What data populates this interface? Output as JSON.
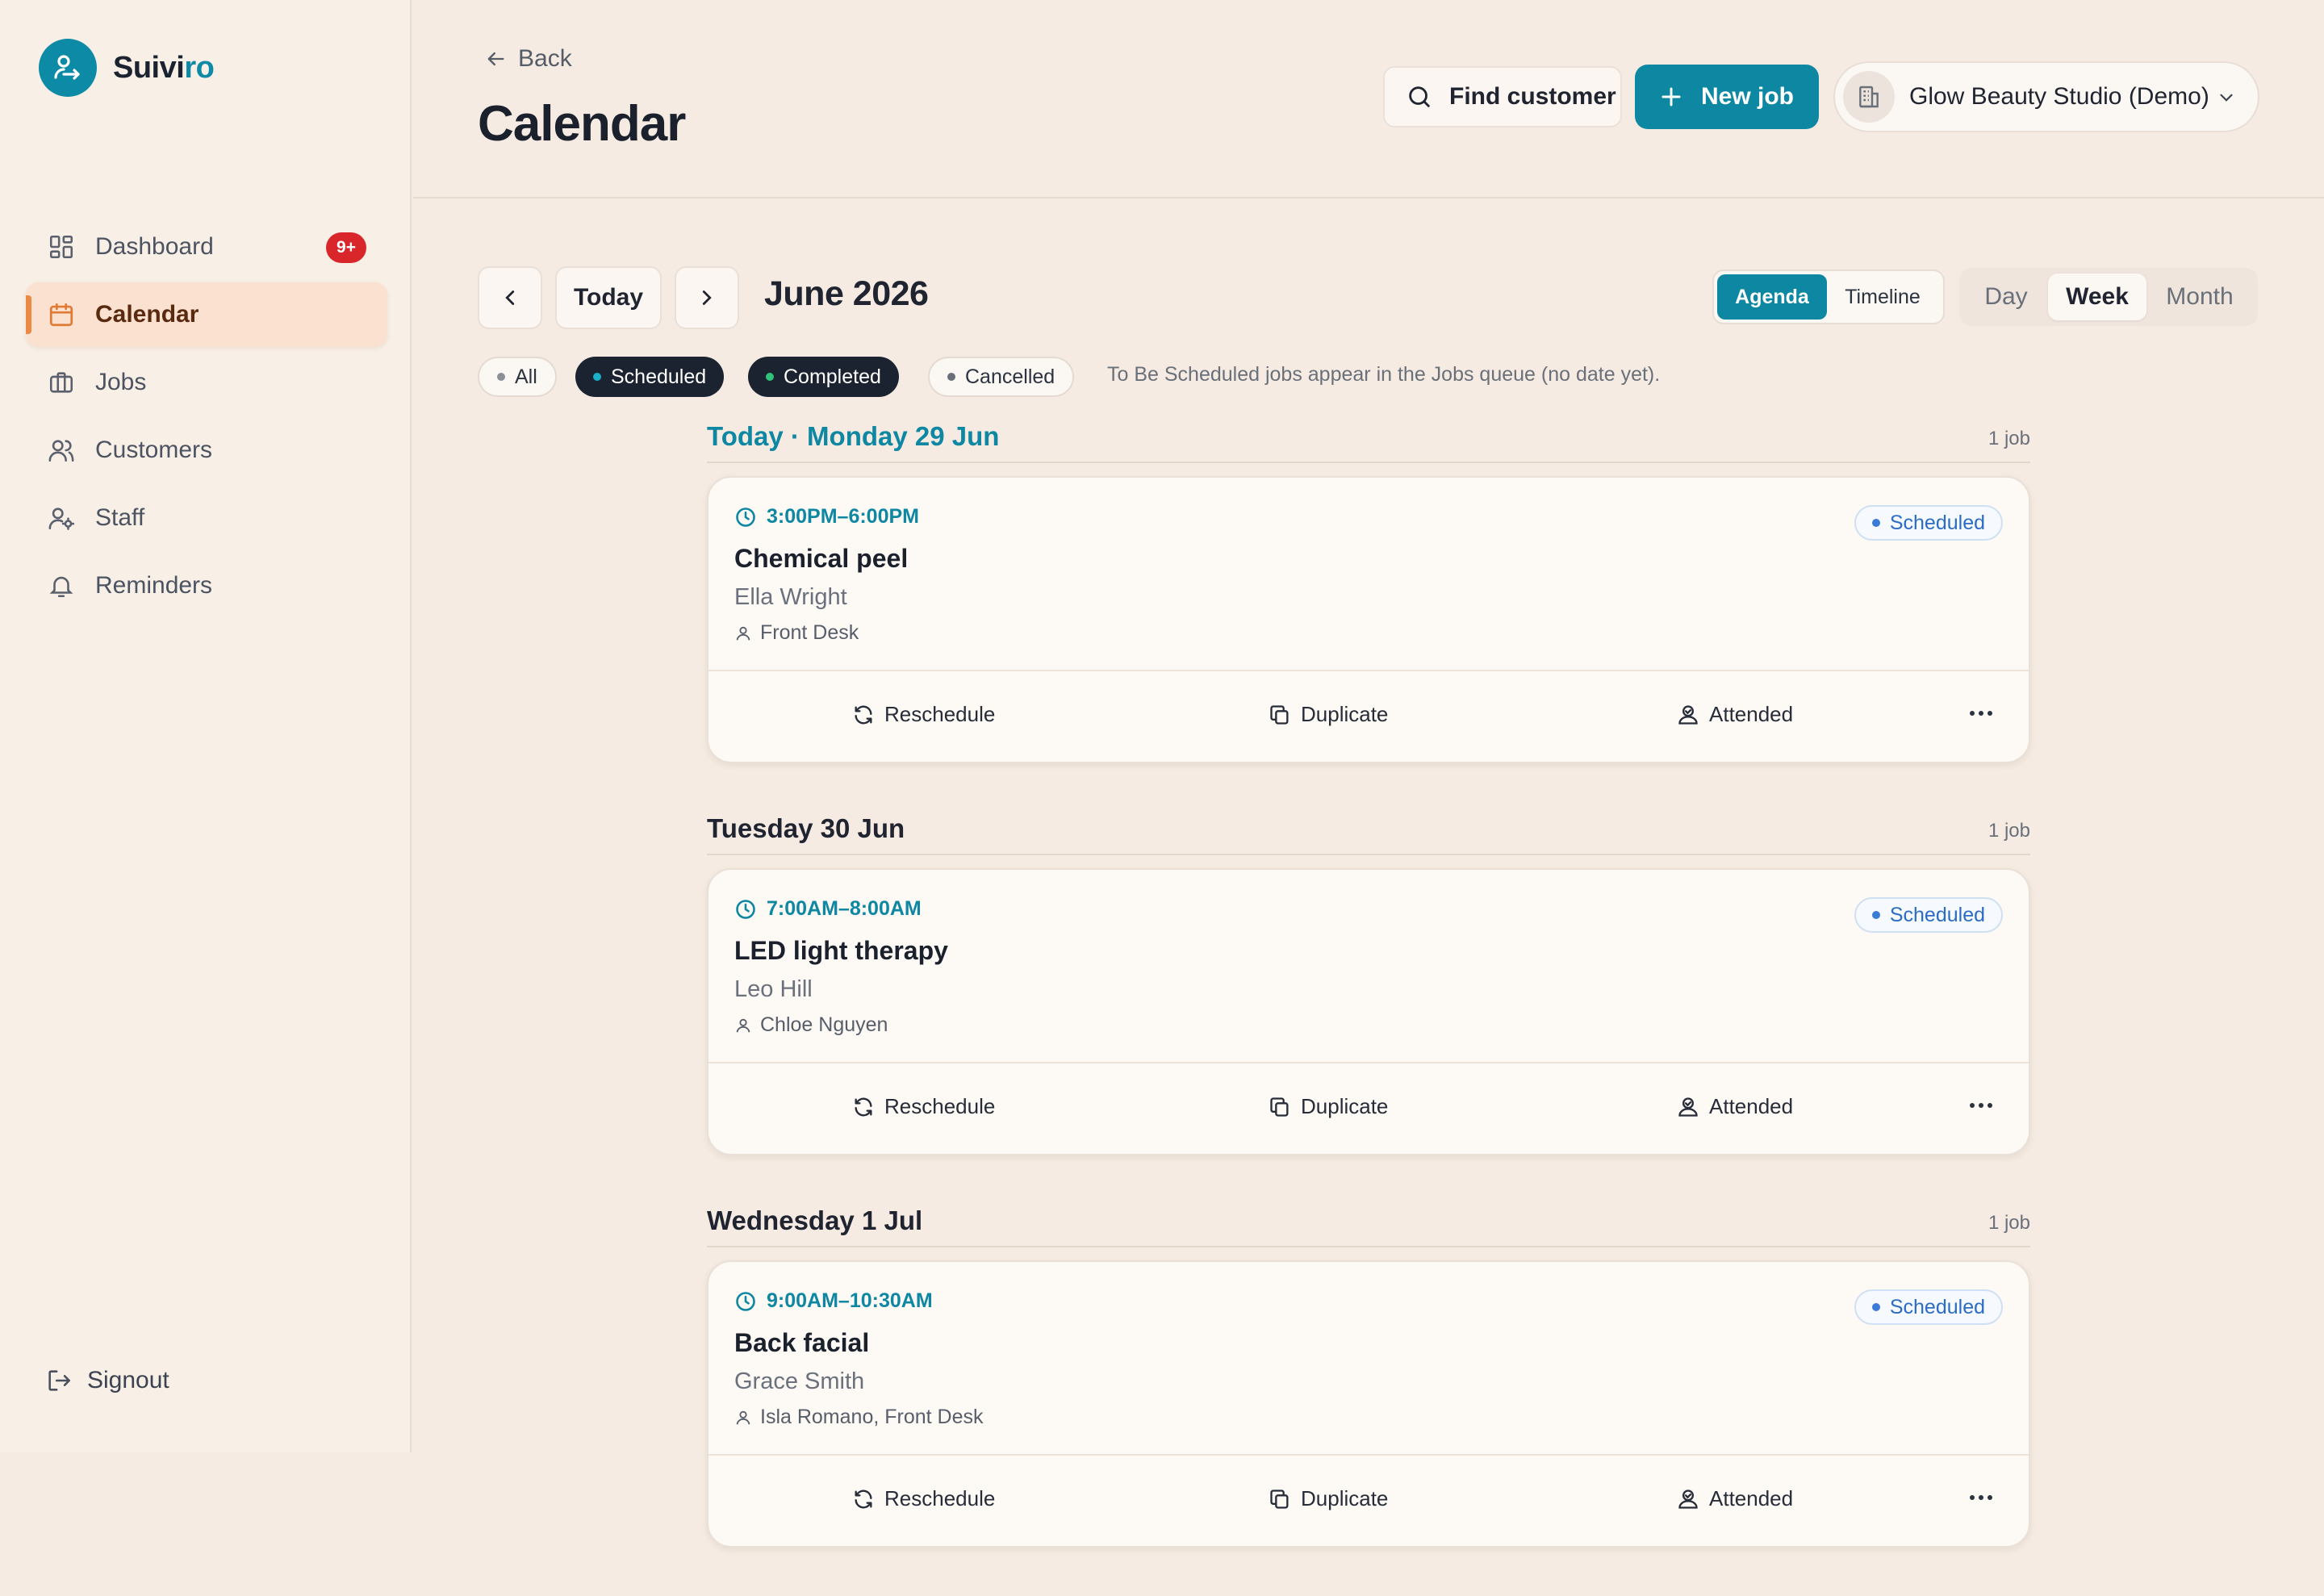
{
  "brand": {
    "name_main": "Suivi",
    "name_accent": "ro",
    "accent_color": "#0d8aa5"
  },
  "sidebar": {
    "items": [
      {
        "label": "Dashboard",
        "icon": "dashboard-icon",
        "badge": "9+"
      },
      {
        "label": "Calendar",
        "icon": "calendar-icon",
        "active": true
      },
      {
        "label": "Jobs",
        "icon": "briefcase-icon"
      },
      {
        "label": "Customers",
        "icon": "users-icon"
      },
      {
        "label": "Staff",
        "icon": "staff-icon"
      },
      {
        "label": "Reminders",
        "icon": "bell-icon"
      }
    ],
    "signout": "Signout"
  },
  "header": {
    "back": "Back",
    "title": "Calendar",
    "find_customer": "Find customer",
    "new_job": "New job",
    "org": "Glow Beauty Studio (Demo)"
  },
  "toolbar": {
    "today": "Today",
    "month": "June 2026",
    "views1": [
      "Agenda",
      "Timeline"
    ],
    "views2": [
      "Day",
      "Week",
      "Month"
    ],
    "active_view1": "Agenda",
    "active_view2": "Week"
  },
  "filters": {
    "chips": [
      "All",
      "Scheduled",
      "Completed",
      "Cancelled"
    ],
    "note": "To Be Scheduled jobs appear in the Jobs queue (no date yet)."
  },
  "agenda": {
    "days": [
      {
        "title": "Today · Monday 29 Jun",
        "count": "1 job",
        "jobs": [
          {
            "time": "3:00PM–6:00PM",
            "service": "Chemical peel",
            "customer": "Ella Wright",
            "staff": "Front Desk",
            "status": "Scheduled"
          }
        ]
      },
      {
        "title": "Tuesday 30 Jun",
        "count": "1 job",
        "jobs": [
          {
            "time": "7:00AM–8:00AM",
            "service": "LED light therapy",
            "customer": "Leo Hill",
            "staff": "Chloe Nguyen",
            "status": "Scheduled"
          }
        ]
      },
      {
        "title": "Wednesday 1 Jul",
        "count": "1 job",
        "jobs": [
          {
            "time": "9:00AM–10:30AM",
            "service": "Back facial",
            "customer": "Grace Smith",
            "staff": "Isla Romano, Front Desk",
            "status": "Scheduled"
          }
        ]
      }
    ],
    "actions": {
      "reschedule": "Reschedule",
      "duplicate": "Duplicate",
      "attended": "Attended"
    }
  },
  "colors": {
    "primary": "#0d87a2",
    "background": "#f5ebe2",
    "badge": "#d9262b",
    "status_blue": "#2b6cc4"
  }
}
